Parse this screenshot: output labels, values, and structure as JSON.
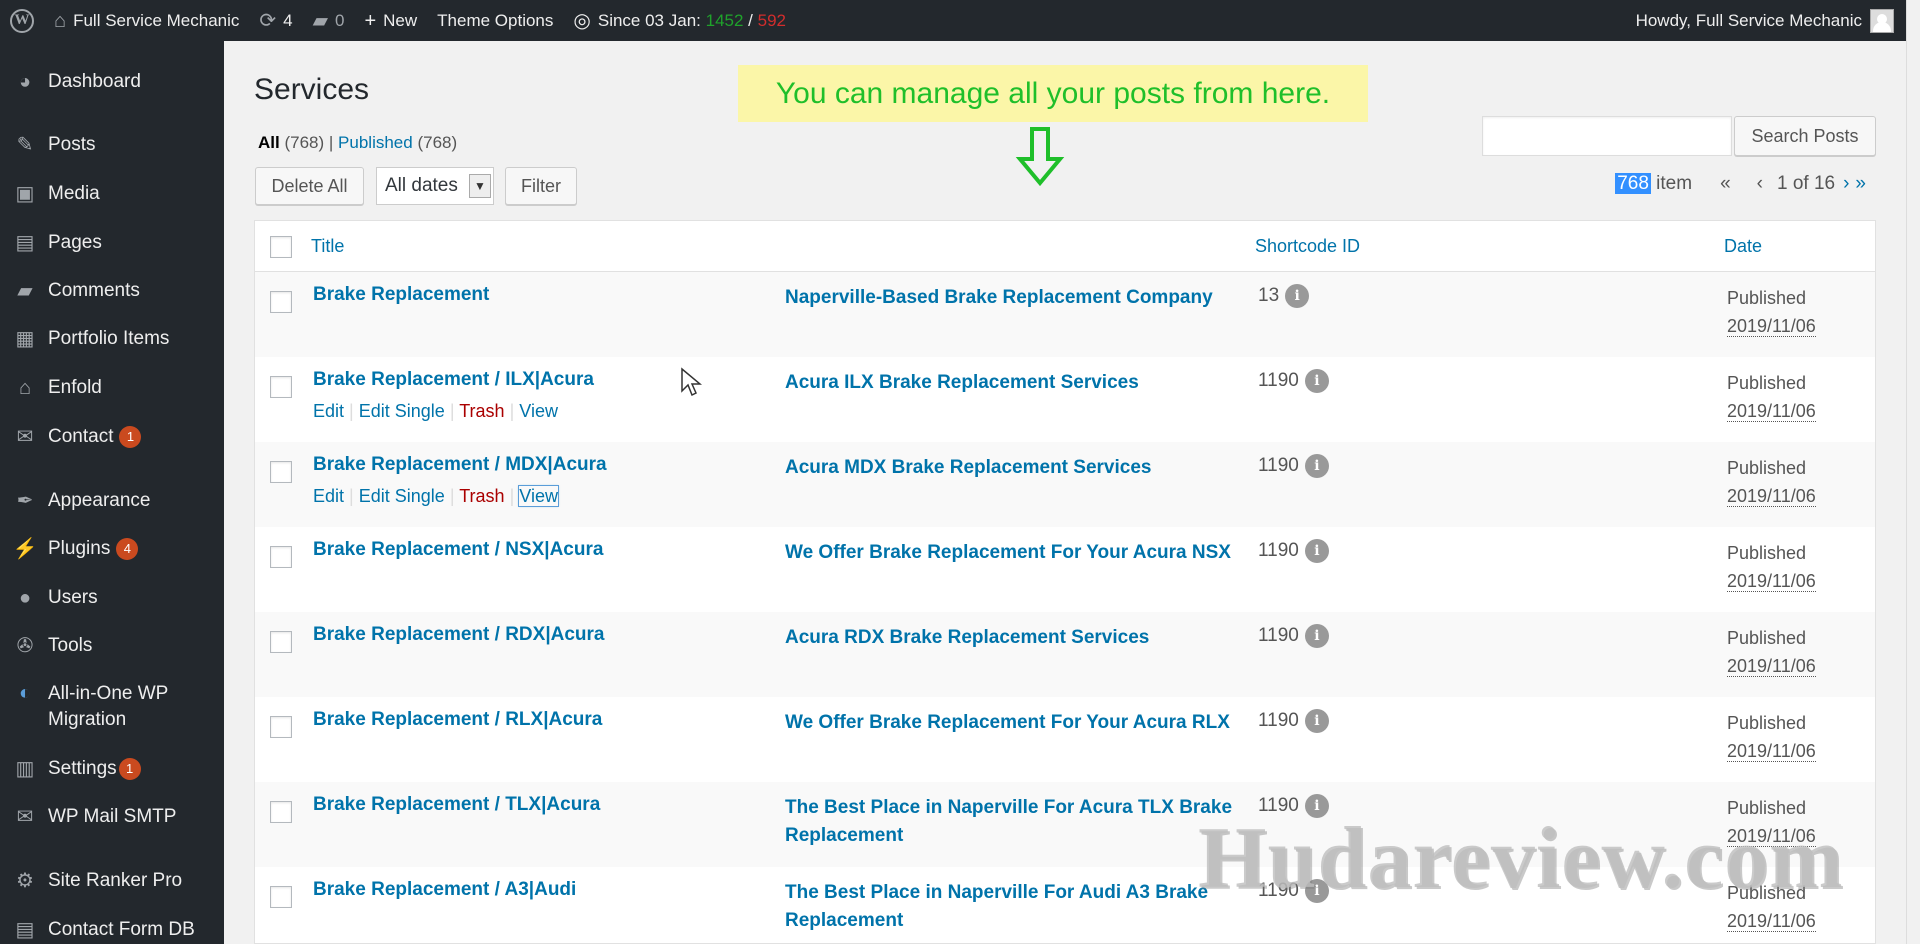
{
  "adminbar": {
    "site_name": "Full Service Mechanic",
    "updates_count": "4",
    "comments_count": "0",
    "new_label": "New",
    "theme_options_label": "Theme Options",
    "since_label": "Since 03 Jan:",
    "since_green": "1452",
    "since_sep": "/",
    "since_red": "592",
    "howdy": "Howdy, Full Service Mechanic"
  },
  "sidebar": {
    "items": [
      {
        "label": "Dashboard",
        "icon": "dashboard-icon"
      },
      {
        "label": "Posts",
        "icon": "pin-icon"
      },
      {
        "label": "Media",
        "icon": "media-icon"
      },
      {
        "label": "Pages",
        "icon": "pages-icon"
      },
      {
        "label": "Comments",
        "icon": "comments-icon"
      },
      {
        "label": "Portfolio Items",
        "icon": "portfolio-icon"
      },
      {
        "label": "Enfold",
        "icon": "home-icon"
      },
      {
        "label": "Contact",
        "icon": "mail-icon",
        "badge": "1"
      },
      {
        "label": "Appearance",
        "icon": "brush-icon"
      },
      {
        "label": "Plugins",
        "icon": "plugin-icon",
        "badge": "4"
      },
      {
        "label": "Users",
        "icon": "user-icon"
      },
      {
        "label": "Tools",
        "icon": "wrench-icon"
      },
      {
        "label": "All-in-One WP",
        "label2": "Migration",
        "icon": "migration-icon"
      },
      {
        "label": "Settings",
        "icon": "settings-icon",
        "badge": "1"
      },
      {
        "label": "WP Mail SMTP",
        "icon": "mail-smtp-icon"
      },
      {
        "label": "Site Ranker Pro",
        "icon": "gear-icon"
      },
      {
        "label": "Contact Form DB",
        "icon": "db-icon"
      }
    ]
  },
  "page": {
    "title": "Services",
    "filter_all": "All",
    "filter_all_count": "(768)",
    "filter_sep": "|",
    "filter_published": "Published",
    "filter_published_count": "(768)",
    "delete_all": "Delete All",
    "dates_select": "All dates",
    "filter_button": "Filter",
    "search_button": "Search Posts",
    "search_value": "",
    "items_count": "768",
    "items_label": "item",
    "first_page": "«",
    "prev_page": "‹",
    "page_of": "1 of 16",
    "next_page": "›",
    "last_page": "»",
    "annotation": "You can manage all your posts from here.",
    "watermark": "Hudareview.com"
  },
  "table": {
    "columns": {
      "title": "Title",
      "shortcode": "Shortcode ID",
      "date": "Date"
    },
    "action_labels": {
      "edit": "Edit",
      "edit_single": "Edit Single",
      "trash": "Trash",
      "view": "View",
      "sep": "|"
    },
    "rows": [
      {
        "title": "Brake Replacement",
        "seo": "Naperville-Based Brake Replacement Company",
        "shortcode": "13",
        "status": "Published",
        "date": "2019/11/06"
      },
      {
        "title": "Brake Replacement / ILX|Acura",
        "seo": "Acura ILX Brake Replacement Services",
        "shortcode": "1190",
        "status": "Published",
        "date": "2019/11/06"
      },
      {
        "title": "Brake Replacement / MDX|Acura",
        "seo": "Acura MDX Brake Replacement Services",
        "shortcode": "1190",
        "status": "Published",
        "date": "2019/11/06"
      },
      {
        "title": "Brake Replacement / NSX|Acura",
        "seo": "We Offer Brake Replacement For Your Acura NSX",
        "shortcode": "1190",
        "status": "Published",
        "date": "2019/11/06"
      },
      {
        "title": "Brake Replacement / RDX|Acura",
        "seo": "Acura RDX Brake Replacement Services",
        "shortcode": "1190",
        "status": "Published",
        "date": "2019/11/06"
      },
      {
        "title": "Brake Replacement / RLX|Acura",
        "seo": "We Offer Brake Replacement For Your Acura RLX",
        "shortcode": "1190",
        "status": "Published",
        "date": "2019/11/06"
      },
      {
        "title": "Brake Replacement / TLX|Acura",
        "seo": "The Best Place in Naperville For Acura TLX Brake Replacement",
        "shortcode": "1190",
        "status": "Published",
        "date": "2019/11/06"
      },
      {
        "title": "Brake Replacement / A3|Audi",
        "seo": "The Best Place in Naperville For Audi A3 Brake Replacement",
        "shortcode": "1190",
        "status": "Published",
        "date": "2019/11/06"
      }
    ]
  }
}
